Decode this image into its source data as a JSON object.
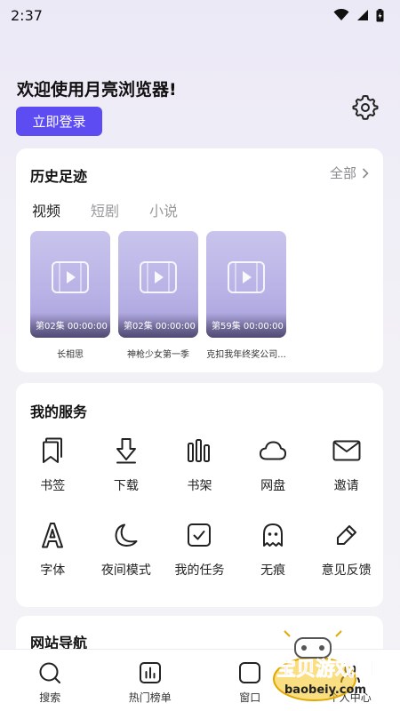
{
  "status_bar": {
    "time": "2:37"
  },
  "header": {
    "welcome": "欢迎使用月亮浏览器!",
    "login_label": "立即登录"
  },
  "history": {
    "title": "历史足迹",
    "see_all": "全部",
    "tabs": [
      {
        "label": "视频",
        "active": true
      },
      {
        "label": "短剧",
        "active": false
      },
      {
        "label": "小说",
        "active": false
      }
    ],
    "items": [
      {
        "episode": "第02集 00:00:00",
        "title": "长相思"
      },
      {
        "episode": "第02集 00:00:00",
        "title": "神枪少女第一季"
      },
      {
        "episode": "第59集 00:00:00",
        "title": "克扣我年终奖公司..."
      }
    ]
  },
  "services": {
    "title": "我的服务",
    "items": [
      {
        "label": "书签",
        "icon": "bookmark-icon"
      },
      {
        "label": "下载",
        "icon": "download-icon"
      },
      {
        "label": "书架",
        "icon": "bookshelf-icon"
      },
      {
        "label": "网盘",
        "icon": "cloud-icon"
      },
      {
        "label": "邀请",
        "icon": "mail-icon"
      },
      {
        "label": "字体",
        "icon": "font-icon"
      },
      {
        "label": "夜间模式",
        "icon": "moon-icon"
      },
      {
        "label": "我的任务",
        "icon": "task-check-icon"
      },
      {
        "label": "无痕",
        "icon": "ghost-icon"
      },
      {
        "label": "意见反馈",
        "icon": "edit-pen-icon"
      }
    ]
  },
  "site_nav": {
    "title": "网站导航"
  },
  "bottom_nav": {
    "items": [
      {
        "label": "搜索",
        "icon": "search-icon"
      },
      {
        "label": "热门榜单",
        "icon": "chart-icon"
      },
      {
        "label": "窗口",
        "icon": "window-icon"
      },
      {
        "label": "个人中心",
        "icon": "user-icon"
      }
    ]
  },
  "watermark": {
    "title": "宝贝游戏网",
    "url": "baobeiy.com"
  },
  "colors": {
    "accent": "#5c4cf2",
    "thumb": "#b9b3e6"
  }
}
